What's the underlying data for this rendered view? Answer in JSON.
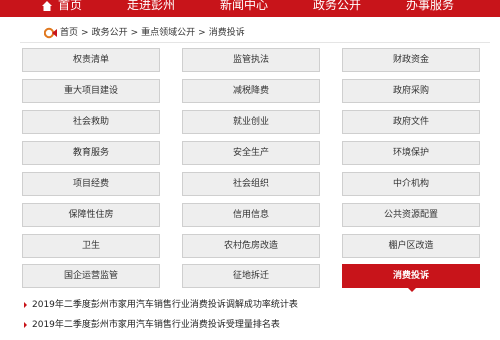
{
  "colors": {
    "brand_red": "#c8141a",
    "cell_bg": "#eeeeee",
    "cell_border": "#cfcfcf"
  },
  "topnav": {
    "items": [
      {
        "label": "首页",
        "icon": "home-icon"
      },
      {
        "label": "走进彭州"
      },
      {
        "label": "新闻中心"
      },
      {
        "label": "政务公开"
      },
      {
        "label": "办事服务"
      }
    ]
  },
  "breadcrumb": {
    "icon": "location-icon",
    "items": [
      "首页",
      "政务公开",
      "重点领域公开",
      "消费投诉"
    ],
    "separator": ">"
  },
  "categories": {
    "items": [
      "权责清单",
      "监管执法",
      "财政资金",
      "重大项目建设",
      "减税降费",
      "政府采购",
      "社会救助",
      "就业创业",
      "政府文件",
      "教育服务",
      "安全生产",
      "环境保护",
      "项目经费",
      "社会组织",
      "中介机构",
      "保障性住房",
      "信用信息",
      "公共资源配置",
      "卫生",
      "农村危房改造",
      "棚户区改造",
      "国企运营监管",
      "征地拆迁",
      "消费投诉"
    ],
    "active": "消费投诉"
  },
  "news": {
    "items": [
      "2019年二季度彭州市家用汽车销售行业消费投诉调解成功率统计表",
      "2019年二季度彭州市家用汽车销售行业消费投诉受理量排名表"
    ]
  }
}
